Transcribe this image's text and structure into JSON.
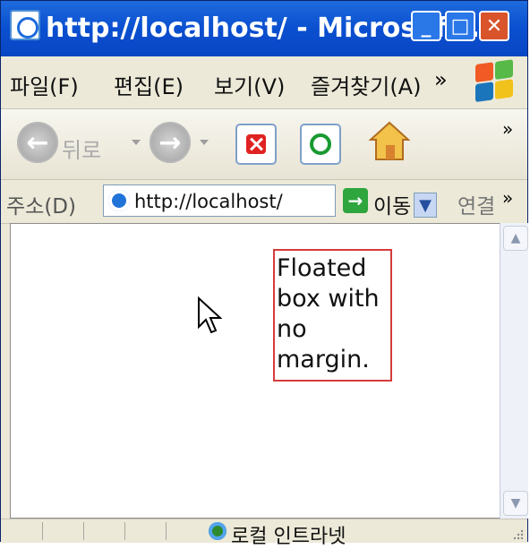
{
  "window": {
    "title": "http://localhost/ - Microsoft..."
  },
  "menu": {
    "items": [
      "파일(F)",
      "편집(E)",
      "보기(V)",
      "즐겨찾기(A)"
    ],
    "more": "»"
  },
  "toolbar": {
    "back_label": "뒤로",
    "more": "»"
  },
  "address": {
    "label": "주소(D)",
    "value": "http://localhost/",
    "go_label": "이동",
    "links_label": "연결",
    "more": "»"
  },
  "page": {
    "float_box_text": "Floated box with no margin."
  },
  "status": {
    "zone_text": "로컬 인트라넷"
  },
  "colors": {
    "title_blue": "#0a4fd0",
    "float_border": "#d53c3c",
    "chrome": "#ece9d8"
  },
  "icons": {
    "window_icon": "ie-icon",
    "back_icon": "back-arrow-icon",
    "forward_icon": "forward-arrow-icon",
    "stop_icon": "stop-icon",
    "refresh_icon": "refresh-icon",
    "home_icon": "home-icon",
    "go_icon": "go-arrow-icon",
    "zone_icon": "local-intranet-icon",
    "cursor_icon": "mouse-pointer-icon"
  }
}
